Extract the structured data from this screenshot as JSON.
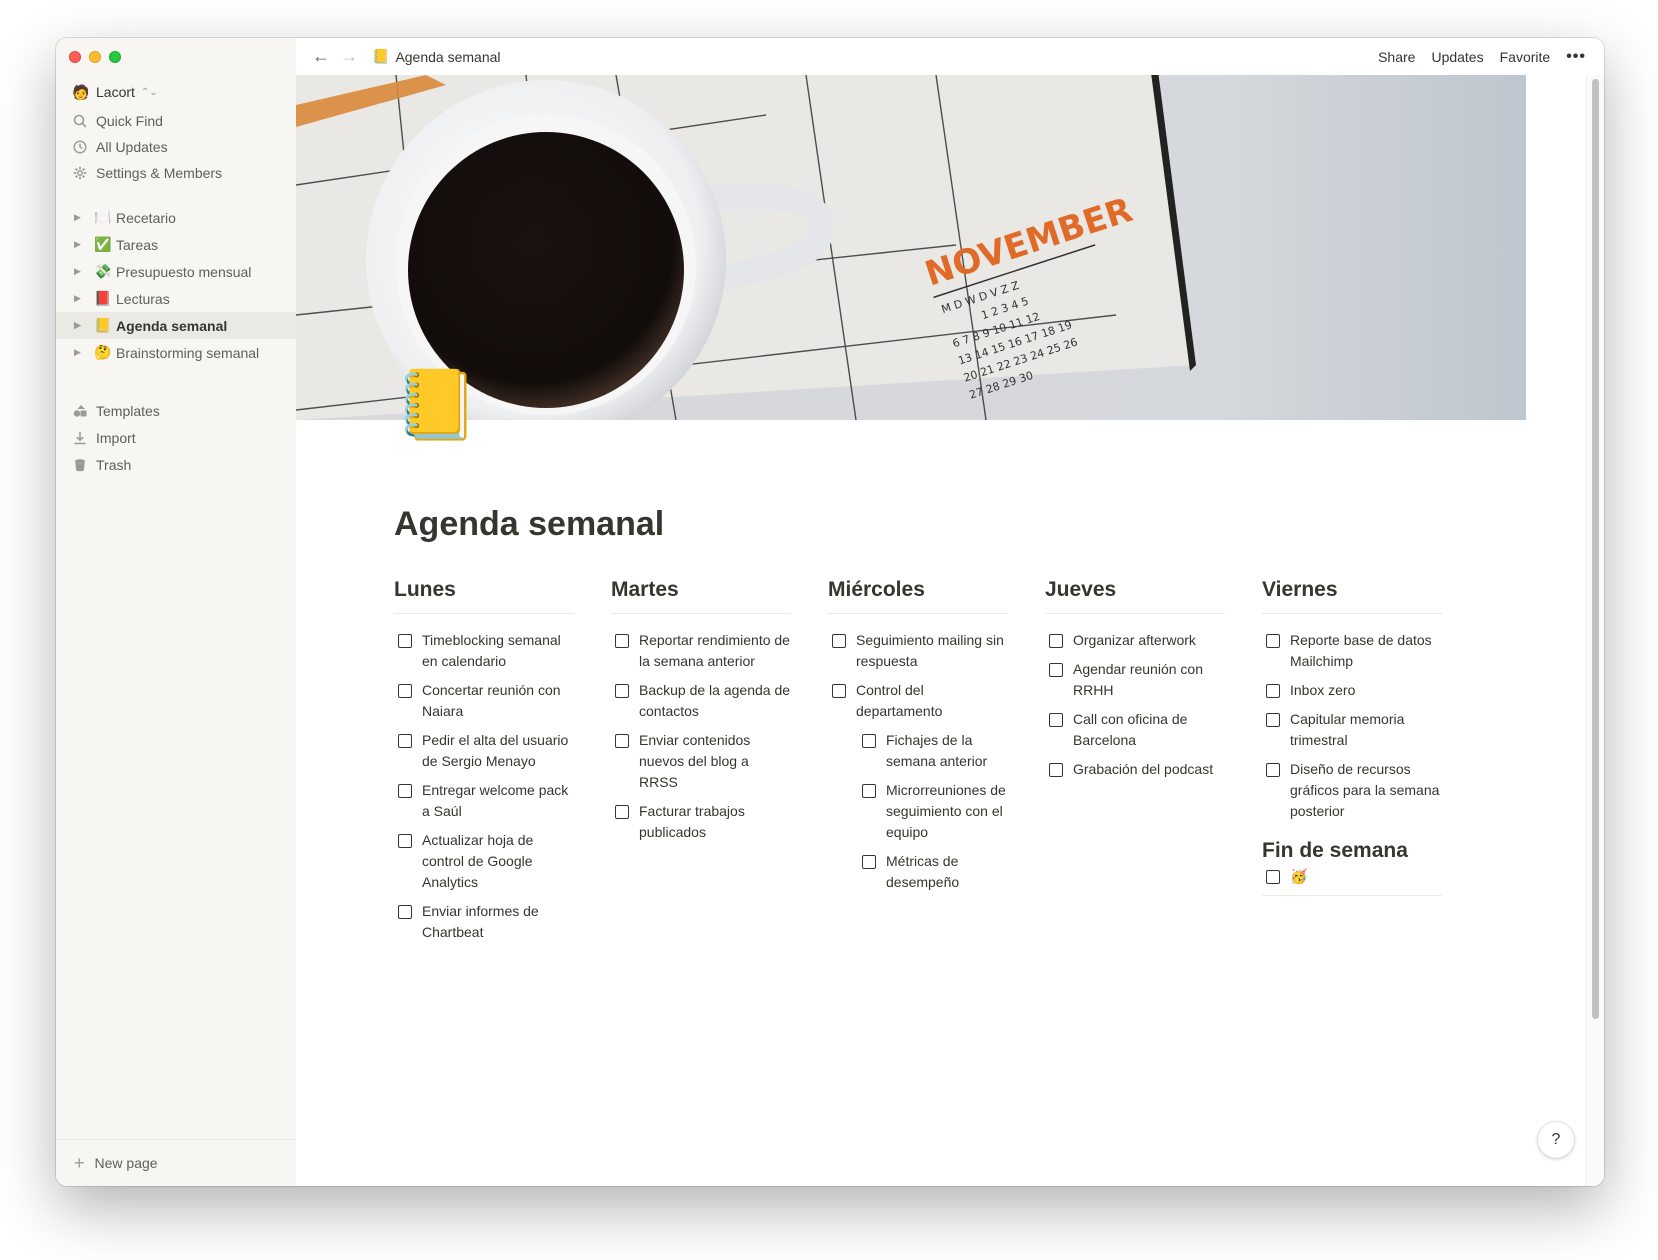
{
  "sidebar": {
    "workspace": "Lacort",
    "nav": [
      {
        "label": "Quick Find",
        "icon": "search-icon"
      },
      {
        "label": "All Updates",
        "icon": "clock-icon"
      },
      {
        "label": "Settings & Members",
        "icon": "gear-icon"
      }
    ],
    "pages": [
      {
        "emoji": "🍽️",
        "label": "Recetario"
      },
      {
        "emoji": "✅",
        "label": "Tareas"
      },
      {
        "emoji": "💸",
        "label": "Presupuesto mensual"
      },
      {
        "emoji": "📕",
        "label": "Lecturas"
      },
      {
        "emoji": "📒",
        "label": "Agenda semanal",
        "active": true
      },
      {
        "emoji": "🤔",
        "label": "Brainstorming semanal"
      }
    ],
    "tools": [
      {
        "label": "Templates",
        "icon": "templates-icon"
      },
      {
        "label": "Import",
        "icon": "import-icon"
      },
      {
        "label": "Trash",
        "icon": "trash-icon"
      }
    ],
    "new_page": "New page"
  },
  "topbar": {
    "breadcrumb_emoji": "📒",
    "breadcrumb": "Agenda semanal",
    "share": "Share",
    "updates": "Updates",
    "favorite": "Favorite",
    "more": "•••"
  },
  "page": {
    "icon": "📒",
    "title": "Agenda semanal",
    "cover_text": {
      "month": "NOVEMBER",
      "weekdays": "M D W D V Z Z",
      "rows": [
        "1 2 3 4 5",
        "6 7 8 9 10 11 12",
        "13 14 15 16 17 18 19",
        "20 21 22 23 24 25 26",
        "27 28 29 30"
      ]
    },
    "columns": [
      {
        "title": "Lunes",
        "items": [
          {
            "text": "Timeblocking semanal en calendario"
          },
          {
            "text": "Concertar reunión con Naiara"
          },
          {
            "text": "Pedir el alta del usuario de Sergio Menayo"
          },
          {
            "text": "Entregar welcome pack a Saúl"
          },
          {
            "text": "Actualizar hoja de control de Google Analytics"
          },
          {
            "text": "Enviar informes de Chartbeat"
          }
        ]
      },
      {
        "title": "Martes",
        "items": [
          {
            "text": "Reportar rendimiento de la semana anterior"
          },
          {
            "text": "Backup de la agenda de contactos"
          },
          {
            "text": "Enviar contenidos nuevos del blog a RRSS"
          },
          {
            "text": "Facturar trabajos publicados"
          }
        ]
      },
      {
        "title": "Miércoles",
        "items": [
          {
            "text": "Seguimiento mailing sin respuesta"
          },
          {
            "text": "Control del departamento"
          },
          {
            "text": "Fichajes de la semana anterior",
            "indent": true
          },
          {
            "text": "Microrreuniones de seguimiento con el equipo",
            "indent": true
          },
          {
            "text": "Métricas de desempeño",
            "indent": true
          }
        ]
      },
      {
        "title": "Jueves",
        "items": [
          {
            "text": "Organizar afterwork"
          },
          {
            "text": "Agendar reunión con RRHH"
          },
          {
            "text": "Call con oficina de Barcelona"
          },
          {
            "text": "Grabación del podcast"
          }
        ]
      },
      {
        "title": "Viernes",
        "items": [
          {
            "text": "Reporte base de datos Mailchimp"
          },
          {
            "text": "Inbox zero"
          },
          {
            "text": "Capitular memoria trimestral"
          },
          {
            "text": "Diseño de recursos gráficos para la semana posterior"
          }
        ]
      }
    ],
    "weekend": {
      "title": "Fin de semana",
      "items": [
        {
          "text": "🥳"
        }
      ]
    },
    "help": "?"
  }
}
